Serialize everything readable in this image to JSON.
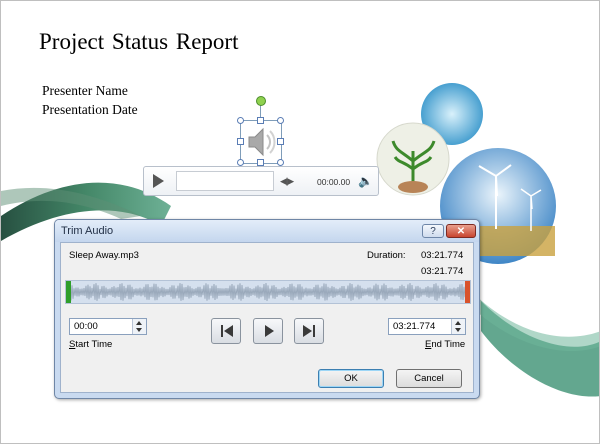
{
  "slide": {
    "title": "Project Status Report",
    "presenter": "Presenter Name",
    "date": "Presentation Date"
  },
  "player": {
    "time": "00:00.00",
    "play_icon": "play-icon",
    "step_icon": "step-icon",
    "volume_icon": "volume-icon"
  },
  "dialog": {
    "title": "Trim Audio",
    "help_label": "?",
    "close_label": "✕",
    "filename": "Sleep Away.mp3",
    "duration_label": "Duration:",
    "duration_value": "03:21.774",
    "end_value_display": "03:21.774",
    "start_time_value": "00:00",
    "start_time_label_first": "S",
    "start_time_label_rest": "tart Time",
    "end_time_value": "03:21.774",
    "end_time_label_first": "E",
    "end_time_label_rest": "nd Time",
    "ok_label": "OK",
    "cancel_label": "Cancel",
    "start_marker_color": "#2f9e2a",
    "end_marker_color": "#d9532c"
  }
}
